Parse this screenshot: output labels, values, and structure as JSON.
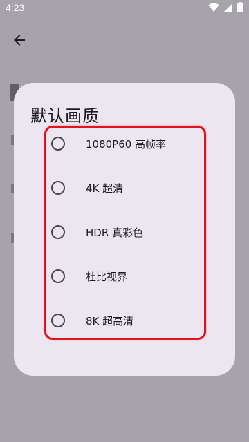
{
  "status_bar": {
    "time": "4:23"
  },
  "dialog": {
    "title": "默认画质",
    "options": [
      {
        "label": "1080P60 高帧率",
        "selected": false
      },
      {
        "label": "4K 超清",
        "selected": false
      },
      {
        "label": "HDR 真彩色",
        "selected": false
      },
      {
        "label": "杜比视界",
        "selected": false
      },
      {
        "label": "8K 超高清",
        "selected": false
      }
    ]
  },
  "colors": {
    "scrim": "#a7a3aa",
    "dialog_bg": "#ece6f0",
    "highlight": "#e0131f"
  }
}
